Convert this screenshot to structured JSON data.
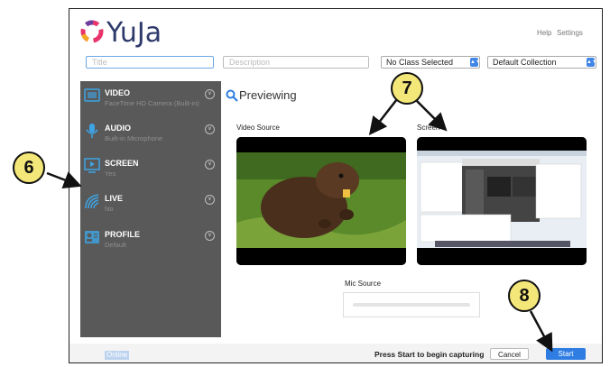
{
  "header": {
    "help_label": "Help",
    "settings_label": "Settings"
  },
  "toolbar": {
    "title_placeholder": "Title",
    "description_placeholder": "Description",
    "class_select_value": "No Class Selected",
    "collection_select_value": "Default Collection"
  },
  "sidebar": {
    "items": [
      {
        "title": "VIDEO",
        "subtitle": "FaceTime HD Camera (Built-in)",
        "icon": "video-icon"
      },
      {
        "title": "AUDIO",
        "subtitle": "Built-in Microphone",
        "icon": "microphone-icon"
      },
      {
        "title": "SCREEN",
        "subtitle": "Yes",
        "icon": "screen-icon"
      },
      {
        "title": "LIVE",
        "subtitle": "No",
        "icon": "live-icon"
      },
      {
        "title": "PROFILE",
        "subtitle": "Default",
        "icon": "profile-icon"
      }
    ]
  },
  "main": {
    "heading": "Previewing",
    "video_source_label": "Video Source",
    "screen_label": "Screen",
    "mic_source_label": "Mic Source"
  },
  "footer": {
    "status": "Online",
    "hint": "Press Start to begin capturing",
    "cancel_label": "Cancel",
    "start_label": "Start"
  },
  "callouts": {
    "six": "6",
    "seven": "7",
    "eight": "8"
  },
  "colors": {
    "accent": "#2f7de2",
    "sidebar_bg": "#595959",
    "callout": "#f4e77a"
  }
}
